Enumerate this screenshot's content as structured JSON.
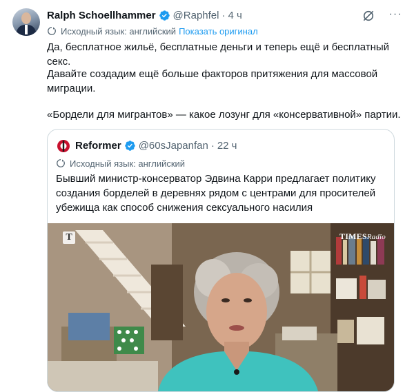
{
  "author": {
    "name": "Ralph Schoellhammer",
    "handle": "@Raphfel",
    "separator": "·",
    "time": "4 ч"
  },
  "translation": {
    "source_label": "Исходный язык: английский",
    "show_original": "Показать оригинал"
  },
  "tweet_text": {
    "p1": "Да, бесплатное жильё, бесплатные деньги и теперь ещё и бесплатный секс.",
    "p2": "Давайте создадим ещё больше факторов притяжения для массовой миграции.",
    "p3": "«Бордели для мигрантов» — какое лозунг для «консервативной» партии."
  },
  "quote": {
    "name": "Reformer",
    "handle": "@60sJapanfan",
    "separator": "·",
    "time": "22 ч",
    "source_label": "Исходный язык: английский",
    "text": "Бывший министр-консерватор Эдвина Карри предлагает политику создания борделей в деревнях рядом с центрами для просителей убежища как способ снижения сексуального насилия",
    "media": {
      "logo_left": "T",
      "logo_right_main": "TIMES",
      "logo_right_sub": "Radio"
    }
  },
  "colors": {
    "verified": "#1d9bf0",
    "link": "#1d9bf0",
    "secondary_text": "#536471",
    "border": "#cfd9de"
  },
  "icons": {
    "verified": "verified-badge-icon",
    "grok": "grok-icon",
    "more": "more-icon",
    "translate": "translate-icon"
  }
}
